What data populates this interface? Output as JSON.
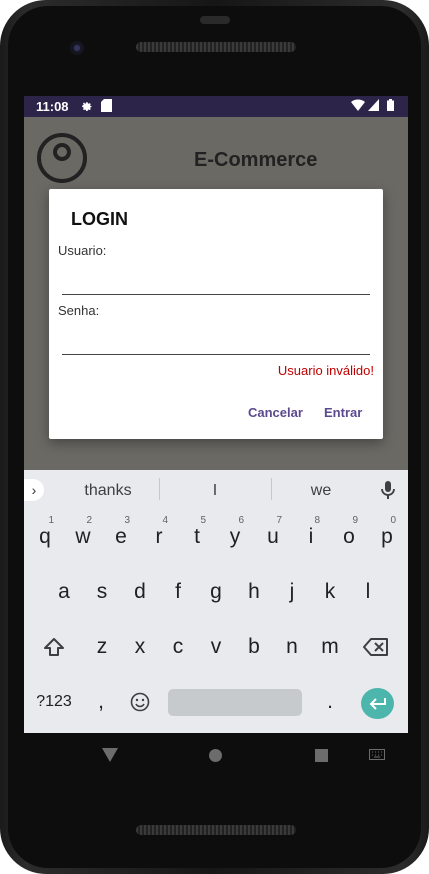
{
  "status_bar": {
    "time": "11:08",
    "icons": [
      "gear-icon",
      "sd-card-icon",
      "wifi-icon",
      "signal-icon",
      "battery-icon"
    ]
  },
  "app": {
    "title": "E-Commerce",
    "logo_icon": "user-circle-icon"
  },
  "dialog": {
    "title": "LOGIN",
    "username_label": "Usuario:",
    "username_value": "",
    "password_label": "Senha:",
    "password_value": "",
    "error_text": "Usuario inválido!",
    "cancel_label": "Cancelar",
    "submit_label": "Entrar"
  },
  "keyboard": {
    "suggestions": [
      "thanks",
      "I",
      "we"
    ],
    "row1": [
      {
        "key": "q",
        "hint": "1"
      },
      {
        "key": "w",
        "hint": "2"
      },
      {
        "key": "e",
        "hint": "3"
      },
      {
        "key": "r",
        "hint": "4"
      },
      {
        "key": "t",
        "hint": "5"
      },
      {
        "key": "y",
        "hint": "6"
      },
      {
        "key": "u",
        "hint": "7"
      },
      {
        "key": "i",
        "hint": "8"
      },
      {
        "key": "o",
        "hint": "9"
      },
      {
        "key": "p",
        "hint": "0"
      }
    ],
    "row2": [
      "a",
      "s",
      "d",
      "f",
      "g",
      "h",
      "j",
      "k",
      "l"
    ],
    "row3": [
      "z",
      "x",
      "c",
      "v",
      "b",
      "n",
      "m"
    ],
    "symbols_label": "?123",
    "comma": ",",
    "period": "."
  },
  "colors": {
    "status_bar": "#2c2449",
    "accent": "#5b4a8e",
    "error": "#c00000",
    "enter_key": "#4db6ac"
  }
}
